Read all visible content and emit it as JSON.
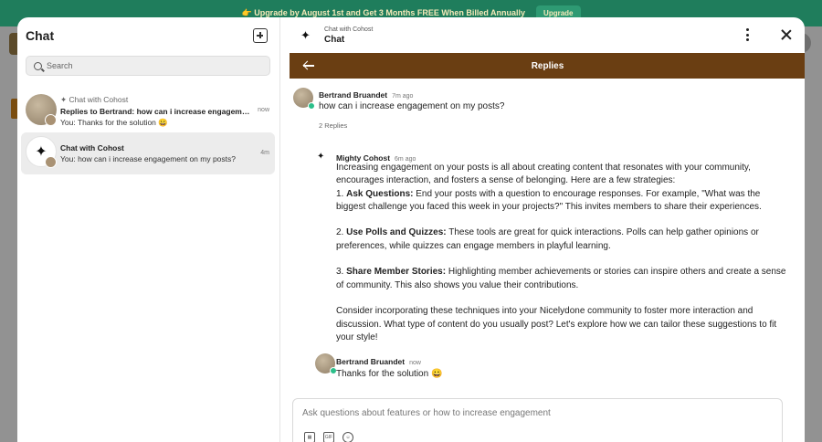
{
  "banner": {
    "text": "👉 Upgrade by August 1st and Get 3 Months FREE When Billed Annually",
    "cta": "Upgrade"
  },
  "left": {
    "title": "Chat",
    "new_chat_icon": "new-chat-icon",
    "search_placeholder": "Search",
    "conversations": [
      {
        "context": "Chat with Cohost",
        "title": "Replies to Bertrand: how can i increase engagement on my posts?",
        "preview": "You: Thanks for the solution 😀",
        "time": "now"
      },
      {
        "title": "Chat with Cohost",
        "preview": "You: how can i increase engagement on my posts?",
        "time": "4m"
      }
    ]
  },
  "right": {
    "header_sub": "Chat with Cohost",
    "header_title": "Chat",
    "replies_title": "Replies",
    "original": {
      "author": "Bertrand Bruandet",
      "time": "7m ago",
      "text": "how can i increase engagement on my posts?"
    },
    "replies_count": "2 Replies",
    "ai": {
      "author": "Mighty Cohost",
      "time": "6m ago",
      "intro": "Increasing engagement on your posts is all about creating content that resonates with your community, encourages interaction, and fosters a sense of belonging. Here are a few strategies:",
      "items": [
        {
          "num": "1.",
          "head": "Ask Questions:",
          "body": "End your posts with a question to encourage responses. For example, \"What was the biggest challenge you faced this week in your projects?\" This invites members to share their experiences."
        },
        {
          "num": "2.",
          "head": "Use Polls and Quizzes:",
          "body": "These tools are great for quick interactions. Polls can help gather opinions or preferences, while quizzes can engage members in playful learning."
        },
        {
          "num": "3.",
          "head": "Share Member Stories:",
          "body": "Highlighting member achievements or stories can inspire others and create a sense of community. This also shows you value their contributions."
        }
      ],
      "outro": "Consider incorporating these techniques into your Nicelydone community to foster more interaction and discussion. What type of content do you usually post? Let's explore how we can tailor these suggestions to fit your style!"
    },
    "reply": {
      "author": "Bertrand Bruandet",
      "time": "now",
      "text": "Thanks for the solution 😀"
    },
    "composer_placeholder": "Ask questions about features or how to increase engagement"
  },
  "colors": {
    "banner_bg": "#1f7d5c",
    "replies_bar": "#6a3e12",
    "online": "#2bbf8a"
  }
}
